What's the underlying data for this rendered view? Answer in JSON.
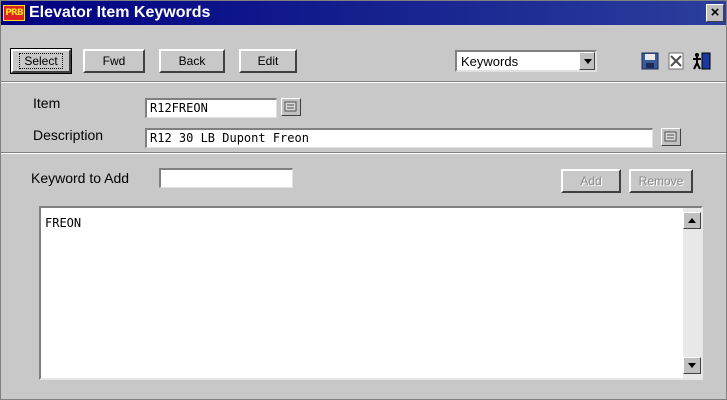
{
  "window": {
    "logo_text": "PRB",
    "title": "Elevator Item Keywords",
    "close_glyph": "×"
  },
  "toolbar": {
    "select_label": "Select",
    "fwd_label": "Fwd",
    "back_label": "Back",
    "edit_label": "Edit",
    "view_select": {
      "value": "Keywords"
    },
    "icons": [
      "save-icon",
      "cancel-icon",
      "exit-icon"
    ]
  },
  "form": {
    "item_label": "Item",
    "item_value": "R12FREON",
    "description_label": "Description",
    "description_value": "R12 30 LB Dupont Freon"
  },
  "keywords": {
    "add_label": "Keyword to Add",
    "add_value": "",
    "add_button": "Add",
    "remove_button": "Remove",
    "list": [
      "FREON"
    ]
  }
}
